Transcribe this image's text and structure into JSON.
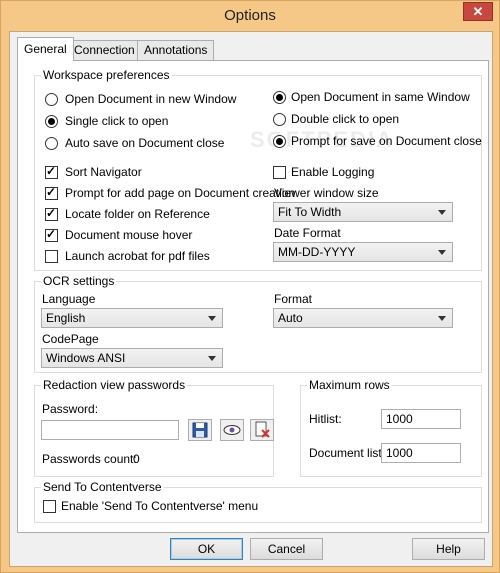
{
  "window": {
    "title": "Options",
    "close_glyph": "✕"
  },
  "watermark": "SOFTPEDIA",
  "tabs": [
    {
      "label": "General",
      "active": true
    },
    {
      "label": "Connection",
      "active": false
    },
    {
      "label": "Annotations",
      "active": false
    }
  ],
  "workspace": {
    "title": "Workspace preferences",
    "radios_left": [
      {
        "label": "Open Document in new Window",
        "checked": false
      },
      {
        "label": "Single click to open",
        "checked": true
      },
      {
        "label": "Auto save on Document close",
        "checked": false
      }
    ],
    "radios_right": [
      {
        "label": "Open Document in same Window",
        "checked": true
      },
      {
        "label": "Double click to open",
        "checked": false
      },
      {
        "label": "Prompt for save on Document close",
        "checked": true
      }
    ],
    "checks": [
      {
        "label": "Sort Navigator",
        "checked": true
      },
      {
        "label": "Prompt for add page on Document creation",
        "checked": true
      },
      {
        "label": "Locate folder on Reference",
        "checked": true
      },
      {
        "label": "Document mouse hover",
        "checked": true
      },
      {
        "label": "Launch acrobat for pdf files",
        "checked": false
      }
    ],
    "enable_logging": {
      "label": "Enable Logging",
      "checked": false
    },
    "viewer_size": {
      "label": "Viewer window size",
      "value": "Fit To Width"
    },
    "date_format": {
      "label": "Date Format",
      "value": "MM-DD-YYYY"
    }
  },
  "ocr": {
    "title": "OCR settings",
    "language": {
      "label": "Language",
      "value": "English"
    },
    "format": {
      "label": "Format",
      "value": "Auto"
    },
    "codepage": {
      "label": "CodePage",
      "value": "Windows ANSI"
    }
  },
  "redaction": {
    "title": "Redaction view passwords",
    "password_label": "Password:",
    "password_value": "",
    "count_label": "Passwords count:",
    "count_value": "0"
  },
  "max_rows": {
    "title": "Maximum rows",
    "hitlist_label": "Hitlist:",
    "hitlist_value": "1000",
    "doclist_label": "Document list:",
    "doclist_value": "1000"
  },
  "send_to": {
    "title": "Send To Contentverse",
    "enable": {
      "label": "Enable 'Send To Contentverse' menu",
      "checked": false
    }
  },
  "buttons": {
    "ok": "OK",
    "cancel": "Cancel",
    "help": "Help"
  },
  "icons": {
    "save": "floppy-disk-icon",
    "view": "eye-icon",
    "clear": "document-delete-icon",
    "colors": {
      "titlebar": "#f5c887",
      "close": "#c7483e",
      "delete_x": "#d23232",
      "floppy": "#2a5aa8"
    }
  }
}
